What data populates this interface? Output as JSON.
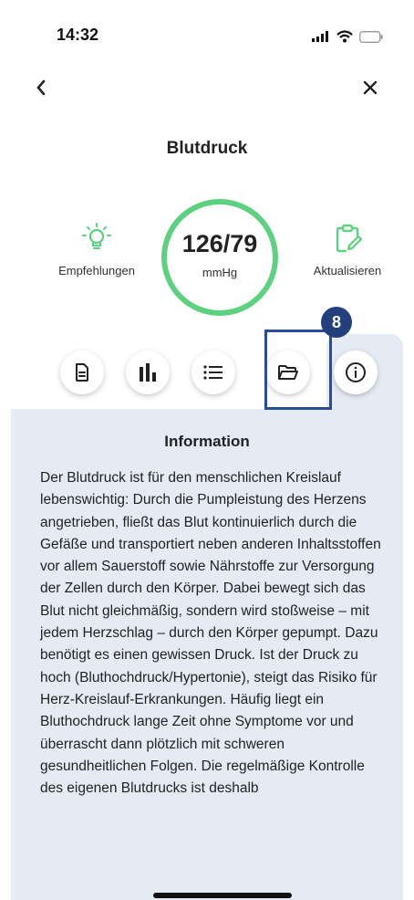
{
  "status_bar": {
    "time": "14:32"
  },
  "header": {
    "title": "Blutdruck"
  },
  "actions": {
    "recommendations_label": "Empfehlungen",
    "update_label": "Aktualisieren"
  },
  "reading": {
    "value": "126/79",
    "unit": "mmHg"
  },
  "tabs": [
    {
      "icon": "document-icon"
    },
    {
      "icon": "bar-chart-icon"
    },
    {
      "icon": "list-icon"
    },
    {
      "icon": "folder-icon"
    },
    {
      "icon": "info-icon",
      "selected": true
    }
  ],
  "highlight_badge": "8",
  "info": {
    "title": "Information",
    "text": "Der Blutdruck ist für den menschlichen Kreislauf lebenswichtig: Durch die Pumpleistung des Herzens angetrieben, fließt das Blut kontinuierlich durch die Gefäße und transportiert neben anderen Inhaltsstoffen vor allem Sauerstoff sowie Nährstoffe zur Versorgung der Zellen durch den Körper. Dabei bewegt sich das Blut nicht gleichmäßig, sondern wird stoßweise – mit jedem Herzschlag – durch den Körper gepumpt. Dazu benötigt es einen gewissen Druck. Ist der Druck zu hoch (Bluthochdruck/Hypertonie), steigt das Risiko für Herz-Kreislauf-Erkrankungen. Häufig liegt ein Bluthochdruck lange Zeit ohne Symptome vor und überrascht dann plötzlich mit schweren gesundheitlichen Folgen. Die regelmäßige Kontrolle des eigenen Blutdrucks ist deshalb"
  },
  "colors": {
    "accent_green": "#5cd17f",
    "highlight_blue": "#2a4d9b",
    "badge_navy": "#243f7e",
    "panel_bg": "#e5ebf4"
  }
}
